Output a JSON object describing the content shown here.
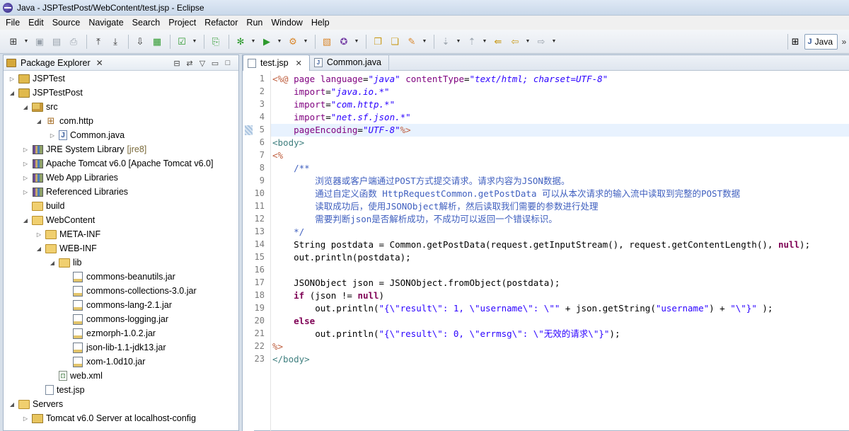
{
  "window": {
    "title": "Java - JSPTestPost/WebContent/test.jsp - Eclipse"
  },
  "menu": [
    "File",
    "Edit",
    "Source",
    "Navigate",
    "Search",
    "Project",
    "Refactor",
    "Run",
    "Window",
    "Help"
  ],
  "perspective": {
    "label": "Java"
  },
  "package_explorer": {
    "title": "Package Explorer",
    "tree": [
      {
        "depth": 0,
        "twisty": "closed",
        "icon": "project",
        "label": "JSPTest"
      },
      {
        "depth": 0,
        "twisty": "open",
        "icon": "project",
        "label": "JSPTestPost"
      },
      {
        "depth": 1,
        "twisty": "open",
        "icon": "src",
        "label": "src"
      },
      {
        "depth": 2,
        "twisty": "open",
        "icon": "package",
        "label": "com.http"
      },
      {
        "depth": 3,
        "twisty": "closed",
        "icon": "java",
        "label": "Common.java"
      },
      {
        "depth": 1,
        "twisty": "closed",
        "icon": "lib",
        "label": "JRE System Library",
        "decoration": "[jre8]"
      },
      {
        "depth": 1,
        "twisty": "closed",
        "icon": "lib",
        "label": "Apache Tomcat v6.0 [Apache Tomcat v6.0]"
      },
      {
        "depth": 1,
        "twisty": "closed",
        "icon": "lib",
        "label": "Web App Libraries"
      },
      {
        "depth": 1,
        "twisty": "closed",
        "icon": "lib",
        "label": "Referenced Libraries"
      },
      {
        "depth": 1,
        "twisty": "none",
        "icon": "folder",
        "label": "build"
      },
      {
        "depth": 1,
        "twisty": "open",
        "icon": "folder",
        "label": "WebContent"
      },
      {
        "depth": 2,
        "twisty": "closed",
        "icon": "folder",
        "label": "META-INF"
      },
      {
        "depth": 2,
        "twisty": "open",
        "icon": "folder",
        "label": "WEB-INF"
      },
      {
        "depth": 3,
        "twisty": "open",
        "icon": "folder",
        "label": "lib"
      },
      {
        "depth": 4,
        "twisty": "none",
        "icon": "jar",
        "label": "commons-beanutils.jar"
      },
      {
        "depth": 4,
        "twisty": "none",
        "icon": "jar",
        "label": "commons-collections-3.0.jar"
      },
      {
        "depth": 4,
        "twisty": "none",
        "icon": "jar",
        "label": "commons-lang-2.1.jar"
      },
      {
        "depth": 4,
        "twisty": "none",
        "icon": "jar",
        "label": "commons-logging.jar"
      },
      {
        "depth": 4,
        "twisty": "none",
        "icon": "jar",
        "label": "ezmorph-1.0.2.jar"
      },
      {
        "depth": 4,
        "twisty": "none",
        "icon": "jar",
        "label": "json-lib-1.1-jdk13.jar"
      },
      {
        "depth": 4,
        "twisty": "none",
        "icon": "jar",
        "label": "xom-1.0d10.jar"
      },
      {
        "depth": 3,
        "twisty": "none",
        "icon": "xml",
        "label": "web.xml"
      },
      {
        "depth": 2,
        "twisty": "none",
        "icon": "jsp",
        "label": "test.jsp"
      },
      {
        "depth": 0,
        "twisty": "open",
        "icon": "folder",
        "label": "Servers"
      },
      {
        "depth": 1,
        "twisty": "closed",
        "icon": "server",
        "label": "Tomcat v6.0 Server at localhost-config"
      }
    ]
  },
  "editor": {
    "tabs": [
      {
        "label": "test.jsp",
        "active": true,
        "icon": "jsp"
      },
      {
        "label": "Common.java",
        "active": false,
        "icon": "java"
      }
    ],
    "current_line": 5,
    "lines": [
      [
        [
          "jspd",
          "<%@"
        ],
        [
          "plain",
          " "
        ],
        [
          "attr",
          "page"
        ],
        [
          "plain",
          " "
        ],
        [
          "attr",
          "language"
        ],
        [
          "plain",
          "="
        ],
        [
          "stri",
          "\"java\""
        ],
        [
          "plain",
          " "
        ],
        [
          "attr",
          "contentType"
        ],
        [
          "plain",
          "="
        ],
        [
          "stri",
          "\"text/html; charset=UTF-8\""
        ]
      ],
      [
        [
          "plain",
          "    "
        ],
        [
          "attr",
          "import"
        ],
        [
          "plain",
          "="
        ],
        [
          "stri",
          "\"java.io.*\""
        ]
      ],
      [
        [
          "plain",
          "    "
        ],
        [
          "attr",
          "import"
        ],
        [
          "plain",
          "="
        ],
        [
          "stri",
          "\"com.http.*\""
        ]
      ],
      [
        [
          "plain",
          "    "
        ],
        [
          "attr",
          "import"
        ],
        [
          "plain",
          "="
        ],
        [
          "stri",
          "\"net.sf.json.*\""
        ]
      ],
      [
        [
          "plain",
          "    "
        ],
        [
          "attr",
          "pageEncoding"
        ],
        [
          "plain",
          "="
        ],
        [
          "stri",
          "\"UTF-8\""
        ],
        [
          "jspd",
          "%>"
        ]
      ],
      [
        [
          "tag",
          "<body>"
        ]
      ],
      [
        [
          "jspd",
          "<%"
        ]
      ],
      [
        [
          "plain",
          "    "
        ],
        [
          "cm",
          "/**"
        ]
      ],
      [
        [
          "cm",
          "        浏览器或客户端通过POST方式提交请求。请求内容为JSON数据。"
        ]
      ],
      [
        [
          "cm",
          "        通过自定义函数 HttpRequestCommon.getPostData 可以从本次请求的输入流中读取到完整的POST数据"
        ]
      ],
      [
        [
          "cm",
          "        读取成功后，使用JSONObject解析，然后读取我们需要的参数进行处理"
        ]
      ],
      [
        [
          "cm",
          "        需要判断json是否解析成功，不成功可以返回一个错误标识。"
        ]
      ],
      [
        [
          "cm",
          "    */"
        ]
      ],
      [
        [
          "plain",
          "    String postdata = Common.getPostData(request.getInputStream(), request.getContentLength(), "
        ],
        [
          "kw",
          "null"
        ],
        [
          "plain",
          ");"
        ]
      ],
      [
        [
          "plain",
          "    out.println(postdata);"
        ]
      ],
      [
        [
          "plain",
          ""
        ]
      ],
      [
        [
          "plain",
          "    JSONObject json = JSONObject.fromObject(postdata);"
        ]
      ],
      [
        [
          "plain",
          "    "
        ],
        [
          "kw",
          "if"
        ],
        [
          "plain",
          " (json != "
        ],
        [
          "kw",
          "null"
        ],
        [
          "plain",
          ")"
        ]
      ],
      [
        [
          "plain",
          "        out.println("
        ],
        [
          "str",
          "\"{\\\"result\\\": 1, \\\"username\\\": \\\"\""
        ],
        [
          "plain",
          " + json.getString("
        ],
        [
          "str",
          "\"username\""
        ],
        [
          "plain",
          ") + "
        ],
        [
          "str",
          "\"\\\"}\""
        ],
        [
          "plain",
          " );"
        ]
      ],
      [
        [
          "plain",
          "    "
        ],
        [
          "kw",
          "else"
        ]
      ],
      [
        [
          "plain",
          "        out.println("
        ],
        [
          "str",
          "\"{\\\"result\\\": 0, \\\"errmsg\\\": \\\"无效的请求\\\"}\""
        ],
        [
          "plain",
          ");"
        ]
      ],
      [
        [
          "jspd",
          "%>"
        ]
      ],
      [
        [
          "tag",
          "</body>"
        ]
      ]
    ]
  }
}
